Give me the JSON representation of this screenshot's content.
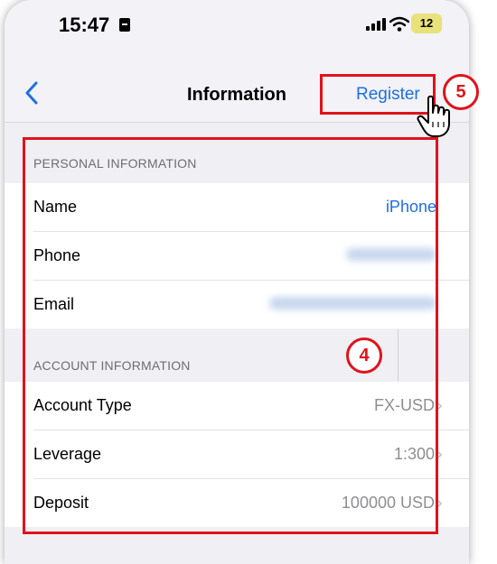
{
  "status_bar": {
    "time": "15:47",
    "battery": "12"
  },
  "nav": {
    "title": "Information",
    "register_label": "Register"
  },
  "personal": {
    "header": "PERSONAL INFORMATION",
    "rows": [
      {
        "label": "Name",
        "value": "iPhone"
      },
      {
        "label": "Phone",
        "value": ""
      },
      {
        "label": "Email",
        "value": ""
      }
    ]
  },
  "account": {
    "header": "ACCOUNT INFORMATION",
    "rows": [
      {
        "label": "Account Type",
        "value": "FX-USD"
      },
      {
        "label": "Leverage",
        "value": "1:300"
      },
      {
        "label": "Deposit",
        "value": "100000 USD"
      }
    ]
  },
  "annotations": {
    "step_4": "4",
    "step_5": "5"
  },
  "colors": {
    "accent": "#1e6fe0",
    "annotation": "#e0131b",
    "background": "#efeff4"
  }
}
